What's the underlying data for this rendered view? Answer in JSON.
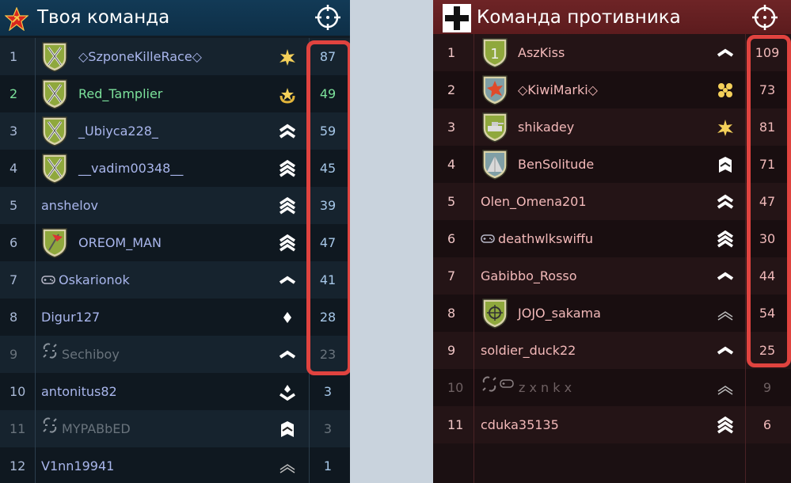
{
  "left": {
    "title": "Твоя команда",
    "colors": {
      "bg": "#111b24",
      "header": "#123a56",
      "name": "#a9b6ec",
      "highlight": "#e0433f"
    },
    "rows": [
      {
        "num": "1",
        "name": "◇SzponeKilleRace◇",
        "score": "87",
        "badge": "swords-emblem-icon",
        "rank": "star-burst-icon"
      },
      {
        "num": "2",
        "name": "Red_Tamplier",
        "score": "49",
        "badge": "swords-emblem-icon",
        "rank": "gold-wreath-icon",
        "style": "green"
      },
      {
        "num": "3",
        "name": "_Ubiyca228_",
        "score": "59",
        "badge": "swords-emblem-icon",
        "rank": "double-chevron-icon"
      },
      {
        "num": "4",
        "name": "__vadim00348__",
        "score": "45",
        "badge": "swords-emblem-icon",
        "rank": "triple-chevron-icon"
      },
      {
        "num": "5",
        "name": "anshelov",
        "score": "39",
        "badge": "",
        "rank": "triple-chevron-icon"
      },
      {
        "num": "6",
        "name": "OREOM_MAN",
        "score": "47",
        "badge": "flag-emblem-icon",
        "rank": "triple-chevron-icon"
      },
      {
        "num": "7",
        "name": "Oskarionok",
        "score": "41",
        "badge": "gamepad-icon",
        "rank": "single-chevron-icon"
      },
      {
        "num": "8",
        "name": "Digur127",
        "score": "28",
        "badge": "",
        "rank": "diamond-icon"
      },
      {
        "num": "9",
        "name": "Sechiboy",
        "score": "23",
        "badge": "disconnected-icon",
        "rank": "single-chevron-icon",
        "style": "dim"
      },
      {
        "num": "10",
        "name": "antonitus82",
        "score": "3",
        "badge": "",
        "rank": "layered-chevron-icon"
      },
      {
        "num": "11",
        "name": "MYPABbED",
        "score": "3",
        "badge": "disconnected-icon",
        "rank": "shield-chevron-icon",
        "style": "dim"
      },
      {
        "num": "12",
        "name": "V1nn19941",
        "score": "1",
        "badge": "",
        "rank": "thin-chevron-icon"
      }
    ]
  },
  "right": {
    "title": "Команда противника",
    "colors": {
      "bg": "#1b1012",
      "header": "#6e2426",
      "name": "#f3b9b9",
      "highlight": "#e0433f"
    },
    "rows": [
      {
        "num": "1",
        "name": "AszKiss",
        "score": "109",
        "badge": "number-one-emblem-icon",
        "rank": "single-chevron-icon"
      },
      {
        "num": "2",
        "name": "◇KiwiMarki◇",
        "score": "73",
        "badge": "explosion-emblem-icon",
        "rank": "gold-stars-icon"
      },
      {
        "num": "3",
        "name": "shikadey",
        "score": "81",
        "badge": "tank-emblem-icon",
        "rank": "star-burst-icon"
      },
      {
        "num": "4",
        "name": "BenSolitude",
        "score": "71",
        "badge": "pyramid-emblem-icon",
        "rank": "shield-chevron-icon"
      },
      {
        "num": "5",
        "name": "Olen_Omena201",
        "score": "47",
        "badge": "",
        "rank": "double-chevron-icon"
      },
      {
        "num": "6",
        "name": "deathwlkswiffu",
        "score": "30",
        "badge": "gamepad-icon",
        "rank": "triple-chevron-icon"
      },
      {
        "num": "7",
        "name": "Gabibbo_Rosso",
        "score": "44",
        "badge": "",
        "rank": "single-chevron-icon"
      },
      {
        "num": "8",
        "name": "JOJO_sakama",
        "score": "54",
        "badge": "crosshair-emblem-icon",
        "rank": "thin-chevron-icon"
      },
      {
        "num": "9",
        "name": "soldier_duck22",
        "score": "25",
        "badge": "",
        "rank": "single-chevron-icon"
      },
      {
        "num": "10",
        "name": "z x n k x",
        "score": "9",
        "badge": "disconnected-gamepad-icon",
        "rank": "thin-chevron-icon",
        "style": "dim"
      },
      {
        "num": "11",
        "name": "cduka35135",
        "score": "6",
        "badge": "",
        "rank": "triple-chevron-icon"
      }
    ]
  }
}
